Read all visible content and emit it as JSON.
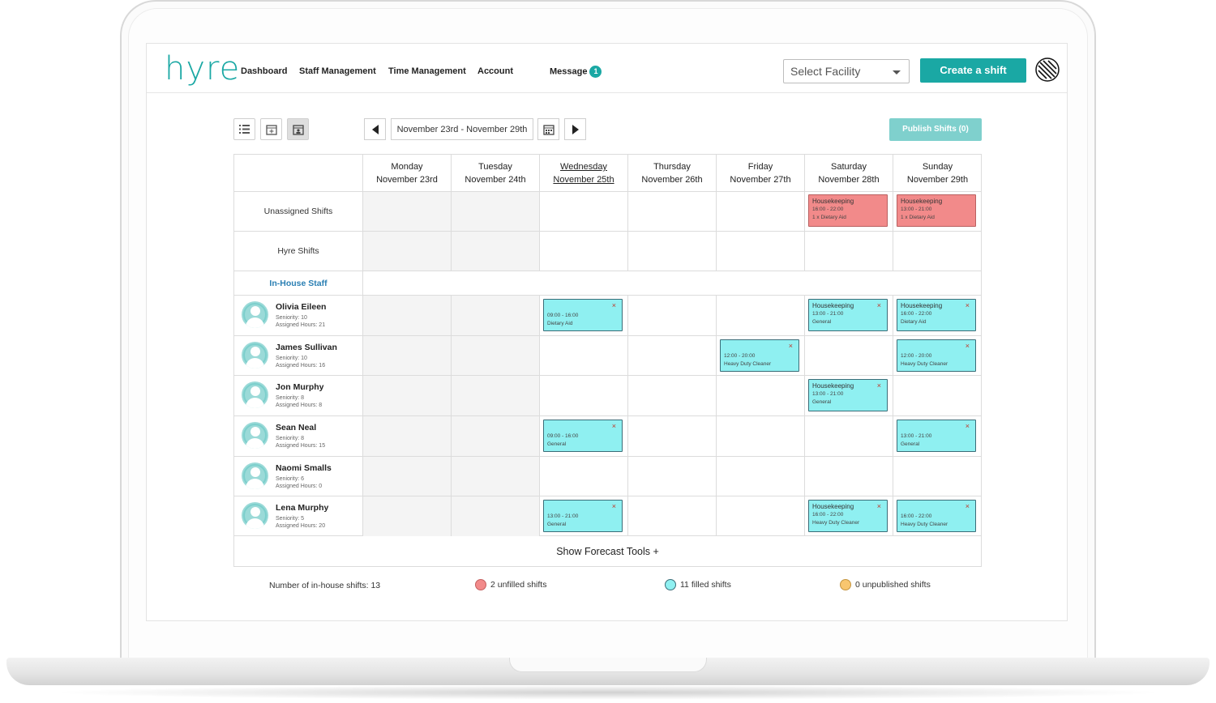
{
  "app": {
    "logo": "hyre"
  },
  "nav": {
    "dashboard": "Dashboard",
    "staff_management": "Staff Management",
    "time_management": "Time Management",
    "account": "Account",
    "message": "Message",
    "message_count": "1"
  },
  "facility": {
    "placeholder": "Select Facility"
  },
  "create_shift": "Create a shift",
  "toolbar": {
    "date_range": "November 23rd - November 29th",
    "publish": "Publish Shifts (0)"
  },
  "days": [
    {
      "day": "Monday",
      "date": "November 23rd"
    },
    {
      "day": "Tuesday",
      "date": "November 24th"
    },
    {
      "day": "Wednesday",
      "date": "November 25th"
    },
    {
      "day": "Thursday",
      "date": "November 26th"
    },
    {
      "day": "Friday",
      "date": "November 27th"
    },
    {
      "day": "Saturday",
      "date": "November 28th"
    },
    {
      "day": "Sunday",
      "date": "November 29th"
    }
  ],
  "rows": {
    "unassigned": "Unassigned Shifts",
    "hyre": "Hyre Shifts",
    "inhouse": "In-House Staff"
  },
  "staff": [
    {
      "name": "Olivia Eileen",
      "seniority": "Seniority: 10",
      "hours": "Assigned Hours: 21"
    },
    {
      "name": "James Sullivan",
      "seniority": "Seniority: 10",
      "hours": "Assigned Hours: 16"
    },
    {
      "name": "Jon Murphy",
      "seniority": "Seniority: 8",
      "hours": "Assigned Hours: 8"
    },
    {
      "name": "Sean Neal",
      "seniority": "Seniority: 8",
      "hours": "Assigned Hours: 15"
    },
    {
      "name": "Naomi Smalls",
      "seniority": "Seniority: 6",
      "hours": "Assigned Hours: 0"
    },
    {
      "name": "Lena Murphy",
      "seniority": "Seniority: 5",
      "hours": "Assigned Hours: 20"
    }
  ],
  "unassigned_shifts": [
    {
      "title": "Housekeeping",
      "time": "16:00 - 22:00",
      "role": "1 x Dietary Aid"
    },
    {
      "title": "Housekeeping",
      "time": "13:00 - 21:00",
      "role": "1 x Dietary Aid"
    }
  ],
  "shifts": [
    {
      "title": "",
      "time": "09:00 - 16:00",
      "role": "Dietary Aid"
    },
    {
      "title": "Housekeeping",
      "time": "13:00 - 21:00",
      "role": "General"
    },
    {
      "title": "Housekeeping",
      "time": "16:00 - 22:00",
      "role": "Dietary Aid"
    },
    {
      "title": "",
      "time": "12:00 - 20:00",
      "role": "Heavy Duty Cleaner"
    },
    {
      "title": "",
      "time": "12:00 - 20:00",
      "role": "Heavy Duty Cleaner"
    },
    {
      "title": "Housekeeping",
      "time": "13:00 - 21:00",
      "role": "General"
    },
    {
      "title": "",
      "time": "09:00 - 16:00",
      "role": "General"
    },
    {
      "title": "",
      "time": "13:00 - 21:00",
      "role": "General"
    },
    {
      "title": "",
      "time": "13:00 - 21:00",
      "role": "General"
    },
    {
      "title": "Housekeeping",
      "time": "16:00 - 22:00",
      "role": "Heavy Duty Cleaner"
    },
    {
      "title": "",
      "time": "16:00 - 22:00",
      "role": "Heavy Duty Cleaner"
    }
  ],
  "close_glyph": "×",
  "forecast": "Show Forecast Tools +",
  "stats": {
    "inhouse": "Number of in-house shifts: 13",
    "unfilled": "2 unfilled shifts",
    "filled": "11 filled shifts",
    "unpublished": "0 unpublished shifts"
  },
  "colors": {
    "brand": "#1aa8a4",
    "filled": "#8ff0f1",
    "unfilled": "#f28a8a",
    "unpublished": "#f8c66f"
  }
}
